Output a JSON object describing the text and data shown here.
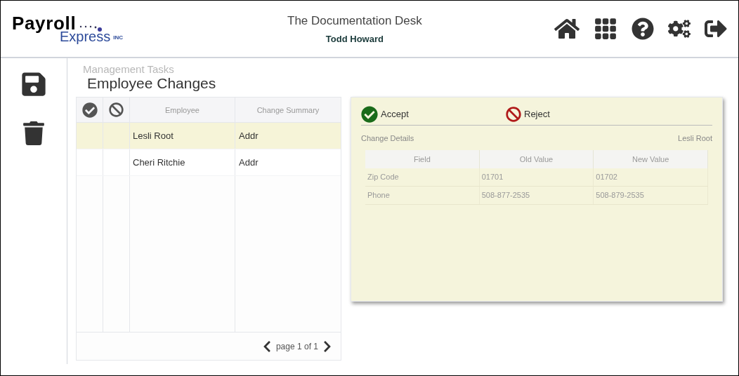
{
  "logo": {
    "word_1": "Payroll",
    "word_2": "Express",
    "suffix": "INC"
  },
  "header": {
    "title": "The Documentation Desk",
    "user": "Todd Howard"
  },
  "breadcrumb": "Management Tasks",
  "page_title": "Employee Changes",
  "employee_table": {
    "columns": [
      "Employee",
      "Change Summary"
    ],
    "rows": [
      {
        "employee": "Lesli Root",
        "summary": "Addr",
        "selected": true
      },
      {
        "employee": "Cheri Ritchie",
        "summary": "Addr",
        "selected": false
      }
    ],
    "pager": "page 1 of 1"
  },
  "details": {
    "accept": "Accept",
    "reject": "Reject",
    "heading": "Change Details",
    "employee": "Lesli Root",
    "columns": [
      "Field",
      "Old Value",
      "New Value"
    ],
    "rows": [
      [
        "Zip Code",
        "01701",
        "01702"
      ],
      [
        "Phone",
        "508-877-2535",
        "508-879-2535"
      ]
    ]
  }
}
